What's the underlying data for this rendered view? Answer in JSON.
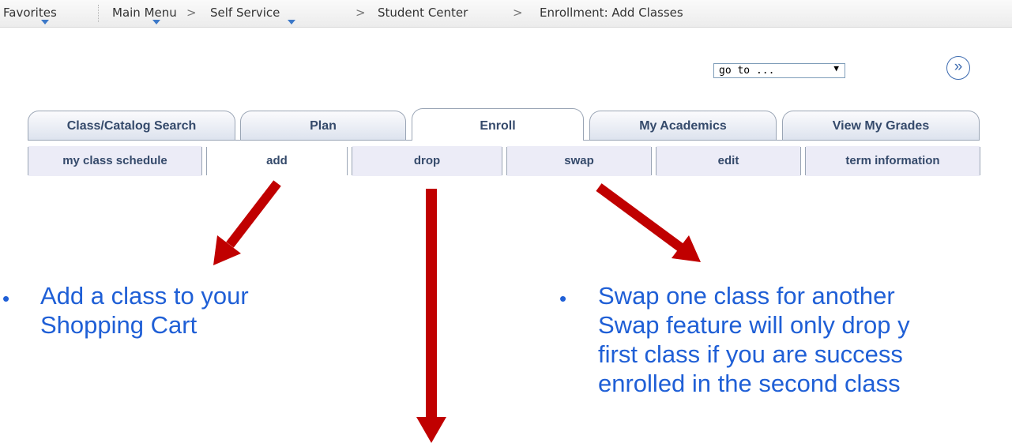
{
  "breadcrumb": {
    "favorites": "Favorites",
    "main_menu": "Main Menu",
    "self_service": "Self Service",
    "student_center": "Student Center",
    "current": "Enrollment: Add Classes",
    "separator": ">"
  },
  "goto": {
    "value": "go to ...",
    "dropdown_glyph": "▼",
    "go_glyph": "»"
  },
  "tabs": [
    {
      "label": "Class/Catalog Search",
      "active": false
    },
    {
      "label": "Plan",
      "active": false
    },
    {
      "label": "Enroll",
      "active": true
    },
    {
      "label": "My Academics",
      "active": false
    },
    {
      "label": "View My Grades",
      "active": false
    }
  ],
  "subtabs": [
    {
      "label": "my class schedule"
    },
    {
      "label": "add"
    },
    {
      "label": "drop"
    },
    {
      "label": "swap"
    },
    {
      "label": "edit"
    },
    {
      "label": "term information"
    }
  ],
  "annotations": {
    "bullet": "•",
    "add_line1": "Add a class to your",
    "add_line2": "Shopping Cart",
    "swap_line1": "Swap one class for another",
    "swap_line2": "Swap feature will only drop y",
    "swap_line3": "first class if you are success",
    "swap_line4": "enrolled in the second class"
  },
  "colors": {
    "arrow": "#c00000",
    "annotation_text": "#1f5fd6",
    "tab_text": "#354a6b",
    "subtab_fill": "#ececf7"
  }
}
